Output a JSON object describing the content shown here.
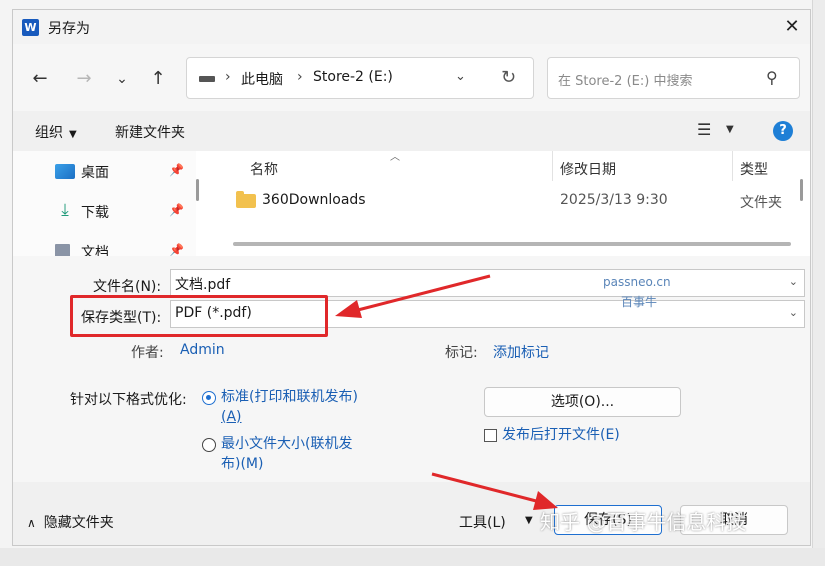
{
  "window": {
    "title": "另存为",
    "app_icon": "W"
  },
  "nav": {
    "address": [
      "此电脑",
      "Store-2 (E:)"
    ],
    "search_placeholder": "在 Store-2 (E:) 中搜索"
  },
  "toolbar": {
    "organize": "组织",
    "new_folder": "新建文件夹",
    "help": "?"
  },
  "sidebar": {
    "items": [
      {
        "label": "桌面"
      },
      {
        "label": "下载"
      },
      {
        "label": "文档"
      }
    ]
  },
  "files": {
    "headers": {
      "name": "名称",
      "date": "修改日期",
      "type": "类型"
    },
    "rows": [
      {
        "name": "360Downloads",
        "date": "2025/3/13 9:30",
        "type": "文件夹"
      }
    ]
  },
  "form": {
    "filename_label": "文件名(N):",
    "filename_value": "文档.pdf",
    "type_label": "保存类型(T):",
    "type_value": "PDF (*.pdf)",
    "author_label": "作者:",
    "author_value": "Admin",
    "tags_label": "标记:",
    "tags_value": "添加标记"
  },
  "watermark": {
    "line1": "passneo.cn",
    "line2": "百事牛",
    "zhihu": "知乎 @百事牛信息科技"
  },
  "optimize": {
    "label": "针对以下格式优化:",
    "option1": "标准(打印和联机发布)",
    "option1_key": "(A)",
    "option2": "最小文件大小(联机发",
    "option2_line2": "布)(M)",
    "selected": "option1",
    "options_button": "选项(O)...",
    "open_after_publish": "发布后打开文件(E)",
    "open_after_publish_checked": false
  },
  "footer": {
    "hide_folders": "隐藏文件夹",
    "tools": "工具(L)",
    "save": "保存(S)",
    "cancel": "取消"
  },
  "colors": {
    "accent": "#1e6fd0",
    "highlight": "#e0282a",
    "link": "#1a5fb4"
  }
}
